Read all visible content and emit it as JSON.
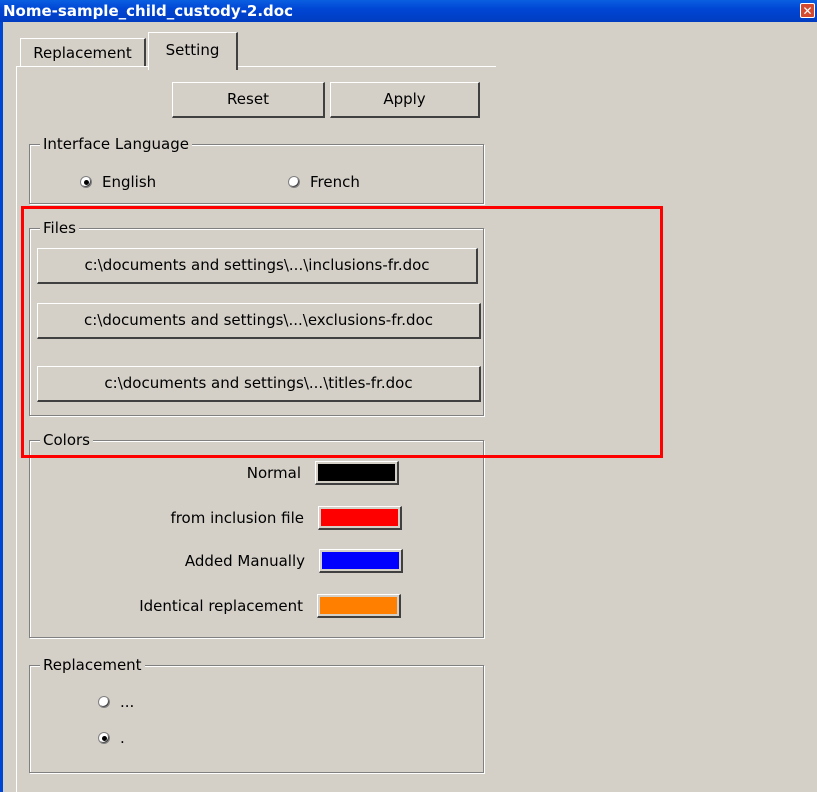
{
  "window": {
    "title": "Nome-sample_child_custody-2.doc"
  },
  "tabs": [
    {
      "label": "Replacement"
    },
    {
      "label": "Setting"
    }
  ],
  "toolbar": {
    "reset_label": "Reset",
    "apply_label": "Apply"
  },
  "interface_language": {
    "legend": "Interface Language",
    "options": [
      {
        "label": "English",
        "selected": true
      },
      {
        "label": "French",
        "selected": false
      }
    ]
  },
  "files": {
    "legend": "Files",
    "buttons": [
      {
        "label": "c:\\documents and settings\\...\\inclusions-fr.doc"
      },
      {
        "label": "c:\\documents and settings\\...\\exclusions-fr.doc"
      },
      {
        "label": "c:\\documents and settings\\...\\titles-fr.doc"
      }
    ]
  },
  "colors": {
    "legend": "Colors",
    "rows": [
      {
        "label": "Normal",
        "color": "#000000"
      },
      {
        "label": "from inclusion file",
        "color": "#ff0000"
      },
      {
        "label": "Added Manually",
        "color": "#0000ff"
      },
      {
        "label": "Identical replacement",
        "color": "#ff8000"
      }
    ]
  },
  "replacement": {
    "legend": "Replacement",
    "options": [
      {
        "label": "...",
        "selected": false
      },
      {
        "label": ".",
        "selected": true
      }
    ]
  },
  "highlight_color": "#ff0000"
}
